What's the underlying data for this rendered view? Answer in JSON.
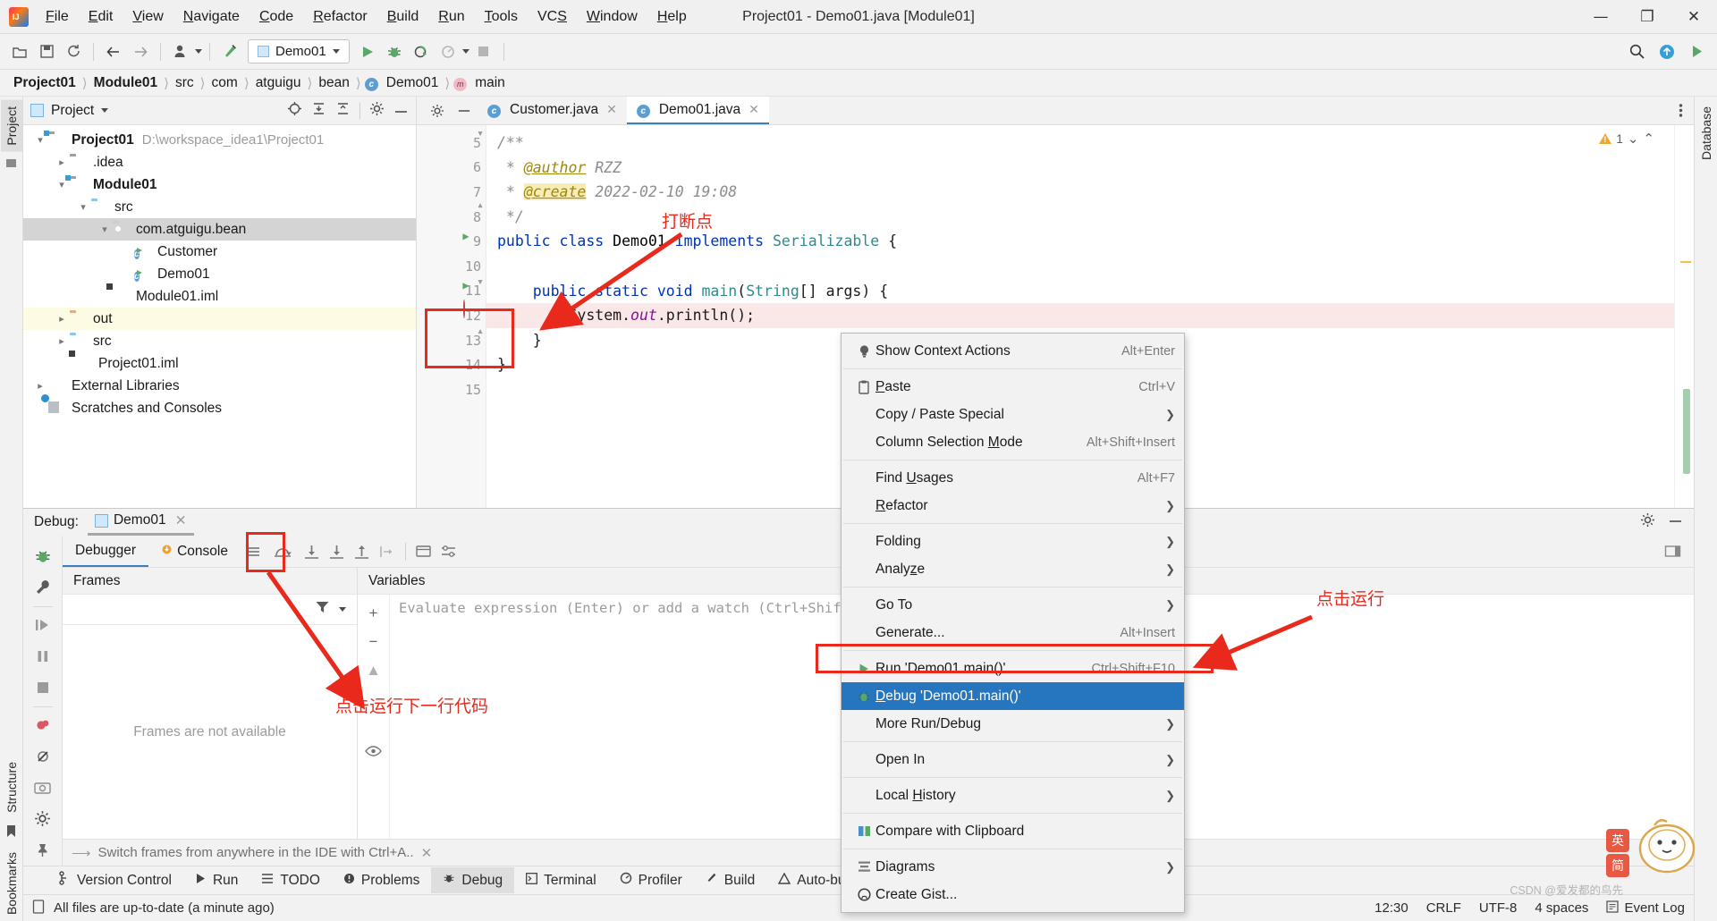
{
  "window": {
    "title": "Project01 - Demo01.java [Module01]",
    "minimize": "—",
    "maximize": "❐",
    "close": "✕"
  },
  "menubar": [
    {
      "label": "File",
      "mnemonic": "F"
    },
    {
      "label": "Edit",
      "mnemonic": "E"
    },
    {
      "label": "View",
      "mnemonic": "V"
    },
    {
      "label": "Navigate",
      "mnemonic": "N"
    },
    {
      "label": "Code",
      "mnemonic": "C"
    },
    {
      "label": "Refactor",
      "mnemonic": "R"
    },
    {
      "label": "Build",
      "mnemonic": "B"
    },
    {
      "label": "Run",
      "mnemonic": "R"
    },
    {
      "label": "Tools",
      "mnemonic": "T"
    },
    {
      "label": "VCS",
      "mnemonic": "S"
    },
    {
      "label": "Window",
      "mnemonic": "W"
    },
    {
      "label": "Help",
      "mnemonic": "H"
    }
  ],
  "toolbar": {
    "open_icon": "folder-open-icon",
    "save_icon": "save-icon",
    "sync_icon": "sync-icon",
    "back_icon": "back-arrow-icon",
    "forward_icon": "forward-arrow-icon",
    "profile_icon": "user-profile-icon",
    "build_icon": "hammer-icon",
    "run_config": "Demo01",
    "run_icon": "run-play-icon",
    "debug_icon": "debug-bug-icon",
    "coverage_icon": "run-with-coverage-icon",
    "profile_run_icon": "profile-run-icon",
    "stop_icon": "stop-icon",
    "search_icon": "search-icon",
    "update_icon": "update-icon",
    "share_icon": "share-run-icon"
  },
  "breadcrumb": [
    {
      "label": "Project01",
      "bold": true,
      "icon": ""
    },
    {
      "label": "Module01",
      "bold": true,
      "icon": ""
    },
    {
      "label": "src",
      "bold": false,
      "icon": ""
    },
    {
      "label": "com",
      "bold": false,
      "icon": ""
    },
    {
      "label": "atguigu",
      "bold": false,
      "icon": ""
    },
    {
      "label": "bean",
      "bold": false,
      "icon": ""
    },
    {
      "label": "Demo01",
      "bold": false,
      "icon": "class-icon"
    },
    {
      "label": "main",
      "bold": false,
      "icon": "method-icon"
    }
  ],
  "left_strip": {
    "project_tab": "Project",
    "bookmarks_tab": "Bookmarks",
    "structure_tab": "Structure"
  },
  "right_strip": {
    "database_tab": "Database"
  },
  "project_panel": {
    "title": "Project",
    "icons": [
      "locate-icon",
      "collapse-all-icon",
      "expand-all-icon",
      "settings-gear-icon",
      "hide-icon"
    ],
    "tree": [
      {
        "label": "Project01",
        "path": "D:\\workspace_idea1\\Project01",
        "indent": 0,
        "arrow": "down",
        "icon": "module-folder-icon",
        "bold": true,
        "state": "normal"
      },
      {
        "label": ".idea",
        "path": "",
        "indent": 1,
        "arrow": "right",
        "icon": "folder-icon",
        "bold": false,
        "state": "normal"
      },
      {
        "label": "Module01",
        "path": "",
        "indent": 1,
        "arrow": "down",
        "icon": "module-folder-icon",
        "bold": true,
        "state": "normal"
      },
      {
        "label": "src",
        "path": "",
        "indent": 2,
        "arrow": "down",
        "icon": "source-folder-icon",
        "bold": false,
        "state": "normal"
      },
      {
        "label": "com.atguigu.bean",
        "path": "",
        "indent": 3,
        "arrow": "down",
        "icon": "package-icon",
        "bold": false,
        "state": "selected"
      },
      {
        "label": "Customer",
        "path": "",
        "indent": 4,
        "arrow": "none",
        "icon": "java-class-icon",
        "bold": false,
        "state": "normal"
      },
      {
        "label": "Demo01",
        "path": "",
        "indent": 4,
        "arrow": "none",
        "icon": "java-class-icon",
        "bold": false,
        "state": "normal"
      },
      {
        "label": "Module01.iml",
        "path": "",
        "indent": 3,
        "arrow": "none",
        "icon": "iml-file-icon",
        "bold": false,
        "state": "normal"
      },
      {
        "label": "out",
        "path": "",
        "indent": 1,
        "arrow": "right",
        "icon": "output-folder-icon",
        "bold": false,
        "state": "highlight"
      },
      {
        "label": "src",
        "path": "",
        "indent": 1,
        "arrow": "right",
        "icon": "source-folder-icon",
        "bold": false,
        "state": "normal"
      },
      {
        "label": "Project01.iml",
        "path": "",
        "indent": 2,
        "arrow": "none",
        "icon": "iml-file-icon",
        "bold": false,
        "state": "normal"
      },
      {
        "label": "External Libraries",
        "path": "",
        "indent": 0,
        "arrow": "right",
        "icon": "libraries-icon",
        "bold": false,
        "state": "normal"
      },
      {
        "label": "Scratches and Consoles",
        "path": "",
        "indent": 0,
        "arrow": "none",
        "icon": "scratches-icon",
        "bold": false,
        "state": "normal"
      }
    ]
  },
  "editor": {
    "tabs": [
      {
        "label": "Customer.java",
        "active": false,
        "icon": "java-class-icon"
      },
      {
        "label": "Demo01.java",
        "active": true,
        "icon": "java-class-icon"
      }
    ],
    "more_icon": "more-options-icon",
    "inspection": {
      "warning_count": "1",
      "warning_icon": "warning-triangle-icon",
      "chevron": "⌄"
    },
    "lines": [
      {
        "num": "5",
        "text": "/**",
        "kind": "comment",
        "marker": "fold-start",
        "highlight": false
      },
      {
        "num": "6",
        "text": " * @author RZZ",
        "kind": "javadoc-author",
        "marker": "",
        "highlight": false
      },
      {
        "num": "7",
        "text": " * @create 2022-02-10 19:08",
        "kind": "javadoc-create",
        "marker": "",
        "highlight": false
      },
      {
        "num": "8",
        "text": " */",
        "kind": "comment",
        "marker": "fold-end",
        "highlight": false
      },
      {
        "num": "9",
        "text": "public class Demo01 implements Serializable {",
        "kind": "class-decl",
        "marker": "run-gutter",
        "highlight": false
      },
      {
        "num": "10",
        "text": "",
        "kind": "blank",
        "marker": "",
        "highlight": false
      },
      {
        "num": "11",
        "text": "    public static void main(String[] args) {",
        "kind": "method-decl",
        "marker": "run-gutter-fold",
        "highlight": false
      },
      {
        "num": "12",
        "text": "        System.out.println();",
        "kind": "statement",
        "marker": "breakpoint",
        "highlight": true
      },
      {
        "num": "13",
        "text": "    }",
        "kind": "brace",
        "marker": "fold-end",
        "highlight": false
      },
      {
        "num": "14",
        "text": "}",
        "kind": "brace",
        "marker": "",
        "highlight": false
      },
      {
        "num": "15",
        "text": "",
        "kind": "blank",
        "marker": "",
        "highlight": false
      }
    ]
  },
  "context_menu": {
    "items": [
      {
        "label": "Show Context Actions",
        "shortcut": "Alt+Enter",
        "icon": "lightbulb-icon",
        "submenu": false,
        "selected": false,
        "mnemonic": ""
      },
      {
        "sep": true
      },
      {
        "label": "Paste",
        "shortcut": "Ctrl+V",
        "icon": "clipboard-paste-icon",
        "submenu": false,
        "selected": false,
        "mnemonic": "P"
      },
      {
        "label": "Copy / Paste Special",
        "shortcut": "",
        "icon": "",
        "submenu": true,
        "selected": false,
        "mnemonic": ""
      },
      {
        "label": "Column Selection Mode",
        "shortcut": "Alt+Shift+Insert",
        "icon": "",
        "submenu": false,
        "selected": false,
        "mnemonic": "M"
      },
      {
        "sep": true
      },
      {
        "label": "Find Usages",
        "shortcut": "Alt+F7",
        "icon": "",
        "submenu": false,
        "selected": false,
        "mnemonic": "U"
      },
      {
        "label": "Refactor",
        "shortcut": "",
        "icon": "",
        "submenu": true,
        "selected": false,
        "mnemonic": "R"
      },
      {
        "sep": true
      },
      {
        "label": "Folding",
        "shortcut": "",
        "icon": "",
        "submenu": true,
        "selected": false,
        "mnemonic": ""
      },
      {
        "label": "Analyze",
        "shortcut": "",
        "icon": "",
        "submenu": true,
        "selected": false,
        "mnemonic": "z"
      },
      {
        "sep": true
      },
      {
        "label": "Go To",
        "shortcut": "",
        "icon": "",
        "submenu": true,
        "selected": false,
        "mnemonic": ""
      },
      {
        "label": "Generate...",
        "shortcut": "Alt+Insert",
        "icon": "",
        "submenu": false,
        "selected": false,
        "mnemonic": ""
      },
      {
        "sep": true
      },
      {
        "label": "Run 'Demo01.main()'",
        "shortcut": "Ctrl+Shift+F10",
        "icon": "run-play-icon",
        "submenu": false,
        "selected": false,
        "mnemonic": ""
      },
      {
        "label": "Debug 'Demo01.main()'",
        "shortcut": "",
        "icon": "debug-bug-icon",
        "submenu": false,
        "selected": true,
        "mnemonic": "D"
      },
      {
        "label": "More Run/Debug",
        "shortcut": "",
        "icon": "",
        "submenu": true,
        "selected": false,
        "mnemonic": ""
      },
      {
        "sep": true
      },
      {
        "label": "Open In",
        "shortcut": "",
        "icon": "",
        "submenu": true,
        "selected": false,
        "mnemonic": ""
      },
      {
        "sep": true
      },
      {
        "label": "Local History",
        "shortcut": "",
        "icon": "",
        "submenu": true,
        "selected": false,
        "mnemonic": "H"
      },
      {
        "sep": true
      },
      {
        "label": "Compare with Clipboard",
        "shortcut": "",
        "icon": "compare-icon",
        "submenu": false,
        "selected": false,
        "mnemonic": ""
      },
      {
        "sep": true
      },
      {
        "label": "Diagrams",
        "shortcut": "",
        "icon": "diagram-icon",
        "submenu": true,
        "selected": false,
        "mnemonic": ""
      },
      {
        "label": "Create Gist...",
        "shortcut": "",
        "icon": "github-icon",
        "submenu": false,
        "selected": false,
        "mnemonic": ""
      }
    ]
  },
  "debug_panel": {
    "label": "Debug:",
    "session": "Demo01",
    "close_icon": "close-icon",
    "settings_icon": "settings-gear-icon",
    "hide_icon": "hide-icon",
    "tabs": [
      {
        "label": "Debugger",
        "active": true,
        "icon": ""
      },
      {
        "label": "Console",
        "active": false,
        "icon": "console-icon"
      }
    ],
    "toolbar_icons": [
      "layout-icon",
      "step-over-icon",
      "step-into-icon",
      "force-step-into-icon",
      "step-out-icon",
      "run-to-cursor-icon",
      "evaluate-icon",
      "settings-icon"
    ],
    "sidebar_icons": [
      "debug-bug-icon",
      "wrench-icon",
      "resume-icon",
      "pause-icon",
      "stop-icon",
      "breakpoints-icon",
      "mute-breakpoints-icon",
      "camera-icon",
      "settings-gear-icon",
      "pin-icon"
    ],
    "frames": {
      "title": "Frames",
      "empty_text": "Frames are not available",
      "filter_icon": "filter-icon",
      "dropdown_icon": "chevron-down-icon"
    },
    "variables": {
      "title": "Variables",
      "evaluate_placeholder": "Evaluate expression (Enter) or add a watch (Ctrl+Shift+Enter)",
      "strip_icons": [
        "add-icon",
        "remove-icon",
        "up-icon",
        "eye-icon"
      ]
    },
    "hint": "Switch frames from anywhere in the IDE with Ctrl+A..",
    "hint_close": "✕"
  },
  "tool_windows": [
    {
      "label": "Version Control",
      "icon": "branch-icon",
      "active": false
    },
    {
      "label": "Run",
      "icon": "run-play-icon",
      "active": false
    },
    {
      "label": "TODO",
      "icon": "todo-list-icon",
      "active": false
    },
    {
      "label": "Problems",
      "icon": "problems-icon",
      "active": false
    },
    {
      "label": "Debug",
      "icon": "debug-bug-icon",
      "active": true
    },
    {
      "label": "Terminal",
      "icon": "terminal-icon",
      "active": false
    },
    {
      "label": "Profiler",
      "icon": "profiler-icon",
      "active": false
    },
    {
      "label": "Build",
      "icon": "hammer-icon",
      "active": false
    },
    {
      "label": "Auto-build",
      "icon": "auto-build-icon",
      "active": false
    }
  ],
  "statusbar": {
    "message": "All files are up-to-date (a minute ago)",
    "message_icon": "file-icon",
    "time": "12:30",
    "line_separator": "CRLF",
    "encoding": "UTF-8",
    "indent": "4 spaces",
    "event_log": "Event Log",
    "event_log_icon": "event-log-icon"
  },
  "annotations": {
    "breakpoint_note": "打断点",
    "run_next_line_note": "点击运行下一行代码",
    "click_run_note": "点击运行",
    "watermark": "CSDN @爱发都的鸟先"
  },
  "colors": {
    "accent": "#2675bf",
    "annotation_red": "#e8291c",
    "breakpoint_red": "#db5860",
    "run_green": "#59a869",
    "keyword_blue": "#0033b3",
    "highlight_line": "#fae7e7"
  }
}
